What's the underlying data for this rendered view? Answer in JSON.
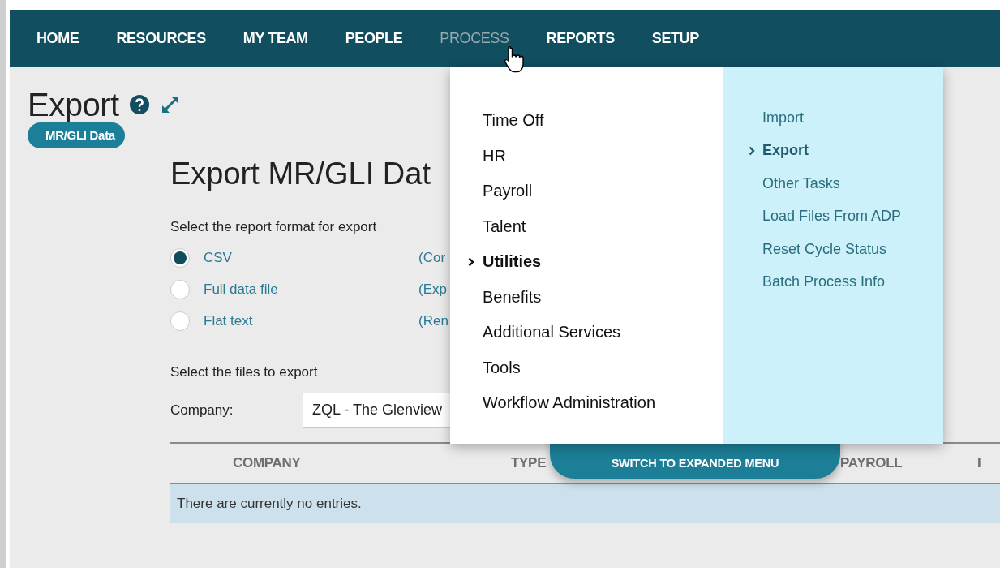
{
  "nav": [
    {
      "label": "HOME",
      "selected": false
    },
    {
      "label": "RESOURCES",
      "selected": false
    },
    {
      "label": "MY TEAM",
      "selected": false
    },
    {
      "label": "PEOPLE",
      "selected": false
    },
    {
      "label": "PROCESS",
      "selected": true
    },
    {
      "label": "REPORTS",
      "selected": false
    },
    {
      "label": "SETUP",
      "selected": false
    }
  ],
  "page": {
    "title": "Export",
    "tag": "MR/GLI Data"
  },
  "form": {
    "title": "Export MR/GLI Dat",
    "format_label": "Select the report format for export",
    "formats": [
      {
        "label": "CSV",
        "description": "(Cor",
        "selected": true
      },
      {
        "label": "Full data file",
        "description": "(Exp",
        "selected": false
      },
      {
        "label": "Flat text",
        "description": "(Ren",
        "selected": false
      }
    ],
    "files_label": "Select the files to export",
    "company_label": "Company:",
    "company_value": "ZQL - The Glenview"
  },
  "table": {
    "columns": [
      "COMPANY",
      "TYPE",
      "PAYROLL",
      "I"
    ],
    "empty_text": "There are currently no entries."
  },
  "menu": {
    "categories": [
      {
        "label": "Time Off",
        "selected": false
      },
      {
        "label": "HR",
        "selected": false
      },
      {
        "label": "Payroll",
        "selected": false
      },
      {
        "label": "Talent",
        "selected": false
      },
      {
        "label": "Utilities",
        "selected": true
      },
      {
        "label": "Benefits",
        "selected": false
      },
      {
        "label": "Additional Services",
        "selected": false
      },
      {
        "label": "Tools",
        "selected": false
      },
      {
        "label": "Workflow Administration",
        "selected": false
      }
    ],
    "items": [
      {
        "label": "Import",
        "selected": false
      },
      {
        "label": "Export",
        "selected": true
      },
      {
        "label": "Other Tasks",
        "selected": false
      },
      {
        "label": "Load Files From ADP",
        "selected": false
      },
      {
        "label": "Reset Cycle Status",
        "selected": false
      },
      {
        "label": "Batch Process Info",
        "selected": false
      }
    ],
    "switch_button": "SWITCH TO EXPANDED MENU"
  }
}
